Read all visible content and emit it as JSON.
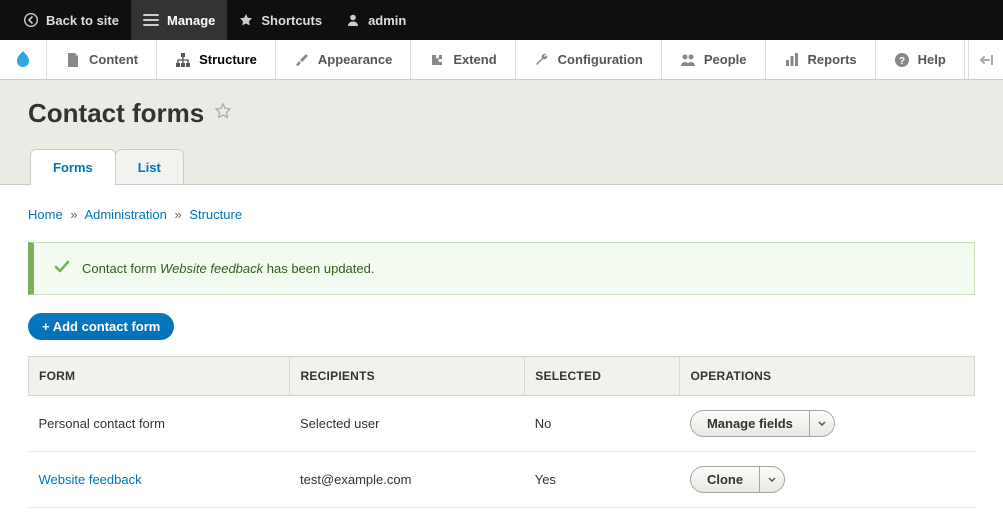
{
  "toolbar": {
    "back": "Back to site",
    "manage": "Manage",
    "shortcuts": "Shortcuts",
    "user": "admin"
  },
  "adminMenu": {
    "content": "Content",
    "structure": "Structure",
    "appearance": "Appearance",
    "extend": "Extend",
    "configuration": "Configuration",
    "people": "People",
    "reports": "Reports",
    "help": "Help"
  },
  "page": {
    "title": "Contact forms"
  },
  "tabs": {
    "forms": "Forms",
    "list": "List"
  },
  "breadcrumbs": {
    "home": "Home",
    "admin": "Administration",
    "structure": "Structure"
  },
  "message": {
    "prefix": "Contact form ",
    "em": "Website feedback",
    "suffix": " has been updated."
  },
  "addButton": "+ Add contact form",
  "table": {
    "headers": {
      "form": "FORM",
      "recipients": "RECIPIENTS",
      "selected": "SELECTED",
      "operations": "OPERATIONS"
    },
    "rows": [
      {
        "form": "Personal contact form",
        "form_link": false,
        "recipients": "Selected user",
        "selected": "No",
        "op": "Manage fields"
      },
      {
        "form": "Website feedback",
        "form_link": true,
        "recipients": "test@example.com",
        "selected": "Yes",
        "op": "Clone"
      }
    ]
  }
}
